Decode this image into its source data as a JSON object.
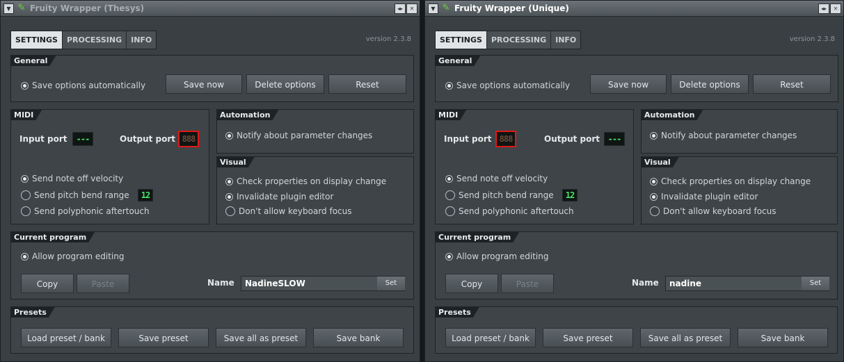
{
  "windows": [
    {
      "title": "Fruity Wrapper (Thesys)",
      "tabs": [
        "SETTINGS",
        "PROCESSING",
        "INFO"
      ],
      "version": "version 2.3.8",
      "general": {
        "title": "General",
        "save_auto": "Save options automatically",
        "save_now": "Save now",
        "delete_options": "Delete options",
        "reset": "Reset"
      },
      "midi": {
        "title": "MIDI",
        "input_port": "Input port",
        "input_value": "---",
        "output_port": "Output port",
        "output_value": "888",
        "note_off": "Send note off velocity",
        "pitch_bend": "Send pitch bend range",
        "pitch_bend_value": "12",
        "poly_aftertouch": "Send polyphonic aftertouch"
      },
      "automation": {
        "title": "Automation",
        "notify": "Notify about parameter changes"
      },
      "visual": {
        "title": "Visual",
        "check_props": "Check properties on display change",
        "invalidate": "Invalidate plugin editor",
        "no_focus": "Don't allow keyboard focus"
      },
      "program": {
        "title": "Current program",
        "allow_edit": "Allow program editing",
        "copy": "Copy",
        "paste": "Paste",
        "name_label": "Name",
        "name_value": "NadineSLOW",
        "set": "Set"
      },
      "presets": {
        "title": "Presets",
        "load": "Load preset / bank",
        "save_preset": "Save preset",
        "save_all": "Save all as preset",
        "save_bank": "Save bank"
      }
    },
    {
      "title": "Fruity Wrapper (Unique)",
      "tabs": [
        "SETTINGS",
        "PROCESSING",
        "INFO"
      ],
      "version": "version 2.3.8",
      "general": {
        "title": "General",
        "save_auto": "Save options automatically",
        "save_now": "Save now",
        "delete_options": "Delete options",
        "reset": "Reset"
      },
      "midi": {
        "title": "MIDI",
        "input_port": "Input port",
        "input_value": "888",
        "output_port": "Output port",
        "output_value": "---",
        "note_off": "Send note off velocity",
        "pitch_bend": "Send pitch bend range",
        "pitch_bend_value": "12",
        "poly_aftertouch": "Send polyphonic aftertouch"
      },
      "automation": {
        "title": "Automation",
        "notify": "Notify about parameter changes"
      },
      "visual": {
        "title": "Visual",
        "check_props": "Check properties on display change",
        "invalidate": "Invalidate plugin editor",
        "no_focus": "Don't allow keyboard focus"
      },
      "program": {
        "title": "Current program",
        "allow_edit": "Allow program editing",
        "copy": "Copy",
        "paste": "Paste",
        "name_label": "Name",
        "name_value": "nadine",
        "set": "Set"
      },
      "presets": {
        "title": "Presets",
        "load": "Load preset / bank",
        "save_preset": "Save preset",
        "save_all": "Save all as preset",
        "save_bank": "Save bank"
      }
    }
  ]
}
